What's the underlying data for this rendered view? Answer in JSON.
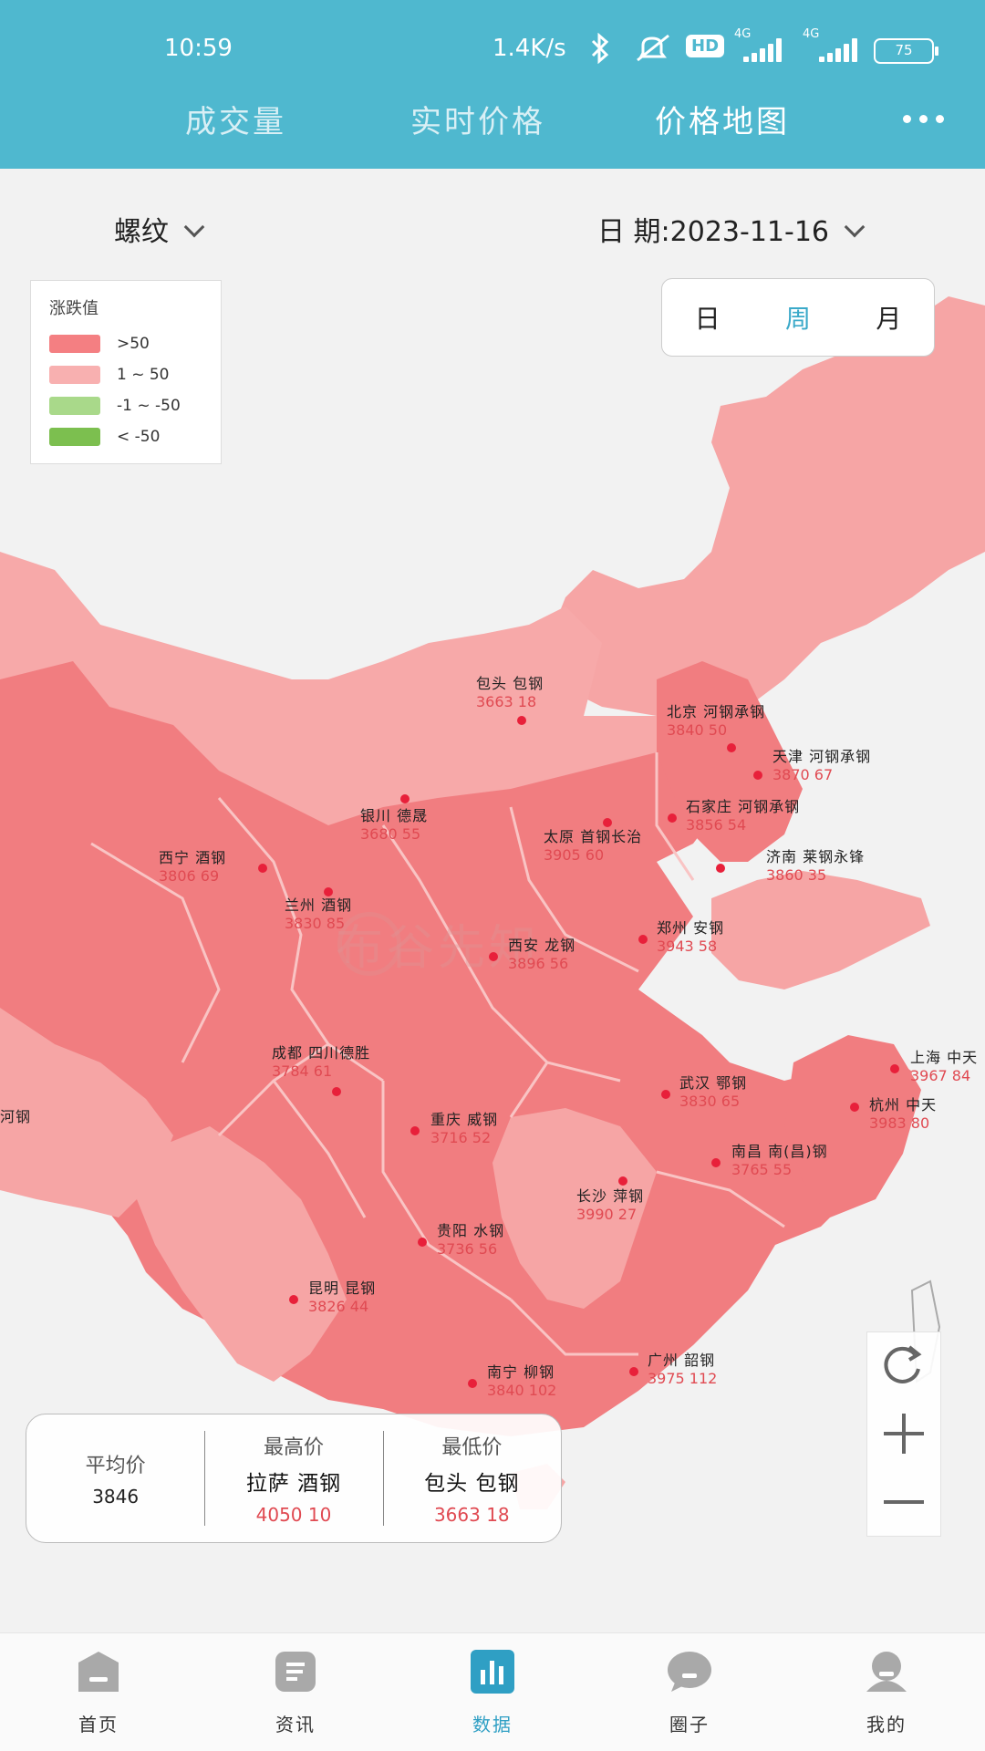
{
  "status_bar": {
    "time": "10:59",
    "network_speed": "1.4K/s",
    "hd_label": "HD",
    "signal_label": "4G",
    "battery": "75"
  },
  "top_tabs": [
    {
      "label": "成交量",
      "active": false
    },
    {
      "label": "实时价格",
      "active": false
    },
    {
      "label": "价格地图",
      "active": true
    }
  ],
  "filters": {
    "product": "螺纹",
    "date_label": "日 期:2023-11-16"
  },
  "legend": {
    "title": "涨跌值",
    "items": [
      {
        "label": ">50",
        "color": "#f47f82"
      },
      {
        "label": "1 ~ 50",
        "color": "#f8b0b0"
      },
      {
        "label": "-1 ~ -50",
        "color": "#a9d98a"
      },
      {
        "label": "< -50",
        "color": "#7cbf4f"
      }
    ]
  },
  "period_toggle": {
    "options": [
      "日",
      "周",
      "月"
    ],
    "selected": "周"
  },
  "cities": [
    {
      "name": "包头 包钢",
      "values": "3663 18"
    },
    {
      "name": "北京 河钢承钢",
      "values": "3840 50"
    },
    {
      "name": "天津 河钢承钢",
      "values": "3870 67"
    },
    {
      "name": "银川 德晟",
      "values": "3680 55"
    },
    {
      "name": "石家庄 河钢承钢",
      "values": "3856 54"
    },
    {
      "name": "太原 首钢长治",
      "values": "3905 60"
    },
    {
      "name": "西宁 酒钢",
      "values": "3806 69"
    },
    {
      "name": "济南 莱钢永锋",
      "values": "3860 35"
    },
    {
      "name": "兰州 酒钢",
      "values": "3830 85"
    },
    {
      "name": "郑州 安钢",
      "values": "3943 58"
    },
    {
      "name": "西安 龙钢",
      "values": "3896 56"
    },
    {
      "name": "成都 四川德胜",
      "values": "3784 61"
    },
    {
      "name": "上海 中天",
      "values": "3967 84"
    },
    {
      "name": "武汉 鄂钢",
      "values": "3830 65"
    },
    {
      "name": "杭州 中天",
      "values": "3983 80"
    },
    {
      "name": "重庆 威钢",
      "values": "3716 52"
    },
    {
      "name": "南昌 南(昌)钢",
      "values": "3765 55"
    },
    {
      "name": "长沙 萍钢",
      "values": "3990 27"
    },
    {
      "name": "贵阳 水钢",
      "values": "3736 56"
    },
    {
      "name": "昆明 昆钢",
      "values": "3826 44"
    },
    {
      "name": "广州 韶钢",
      "values": "3975 112"
    },
    {
      "name": "南宁 柳钢",
      "values": "3840 102"
    },
    {
      "name": "河钢",
      "values": ""
    }
  ],
  "watermark": "布谷先知",
  "summary": {
    "average": {
      "title": "平均价",
      "value": "3846"
    },
    "highest": {
      "title": "最高价",
      "name": "拉萨 酒钢",
      "value": "4050 10"
    },
    "lowest": {
      "title": "最低价",
      "name": "包头 包钢",
      "value": "3663 18"
    }
  },
  "bottom_nav": [
    {
      "label": "首页",
      "icon": "home-icon",
      "active": false
    },
    {
      "label": "资讯",
      "icon": "news-icon",
      "active": false
    },
    {
      "label": "数据",
      "icon": "data-chart-icon",
      "active": true
    },
    {
      "label": "圈子",
      "icon": "chat-bubble-icon",
      "active": false
    },
    {
      "label": "我的",
      "icon": "profile-icon",
      "active": false
    }
  ]
}
